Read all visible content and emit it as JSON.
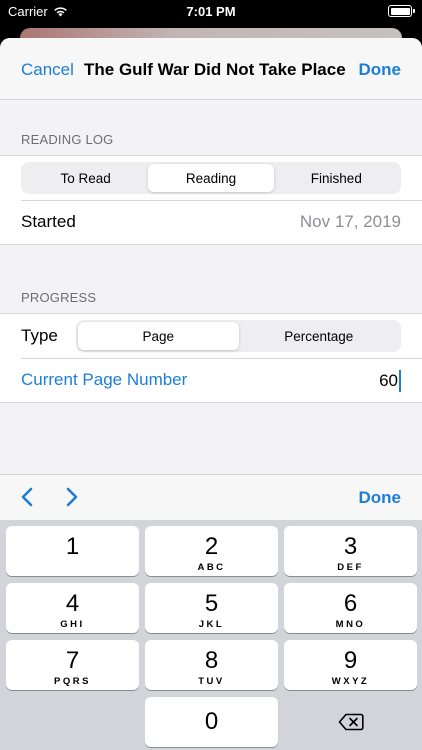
{
  "status_bar": {
    "carrier": "Carrier",
    "time": "7:01 PM"
  },
  "navbar": {
    "cancel_label": "Cancel",
    "title": "The Gulf War Did Not Take Place",
    "done_label": "Done"
  },
  "reading_log": {
    "header": "READING LOG",
    "segments": [
      "To Read",
      "Reading",
      "Finished"
    ],
    "selected": "Reading",
    "started_label": "Started",
    "started_value": "Nov 17, 2019"
  },
  "progress": {
    "header": "PROGRESS",
    "type_label": "Type",
    "type_segments": [
      "Page",
      "Percentage"
    ],
    "type_selected": "Page",
    "current_page_label": "Current Page Number",
    "current_page_value": "60"
  },
  "accessory": {
    "done_label": "Done"
  },
  "keypad": {
    "keys": [
      {
        "num": "1",
        "letters": ""
      },
      {
        "num": "2",
        "letters": "ABC"
      },
      {
        "num": "3",
        "letters": "DEF"
      },
      {
        "num": "4",
        "letters": "GHI"
      },
      {
        "num": "5",
        "letters": "JKL"
      },
      {
        "num": "6",
        "letters": "MNO"
      },
      {
        "num": "7",
        "letters": "PQRS"
      },
      {
        "num": "8",
        "letters": "TUV"
      },
      {
        "num": "9",
        "letters": "WXYZ"
      },
      {
        "num": "0",
        "letters": ""
      }
    ]
  },
  "colors": {
    "accent": "#1c7ed6",
    "grouped_background": "#f2f2f7",
    "secondary_text": "#8e8e93",
    "keypad_background": "#d2d4da"
  }
}
